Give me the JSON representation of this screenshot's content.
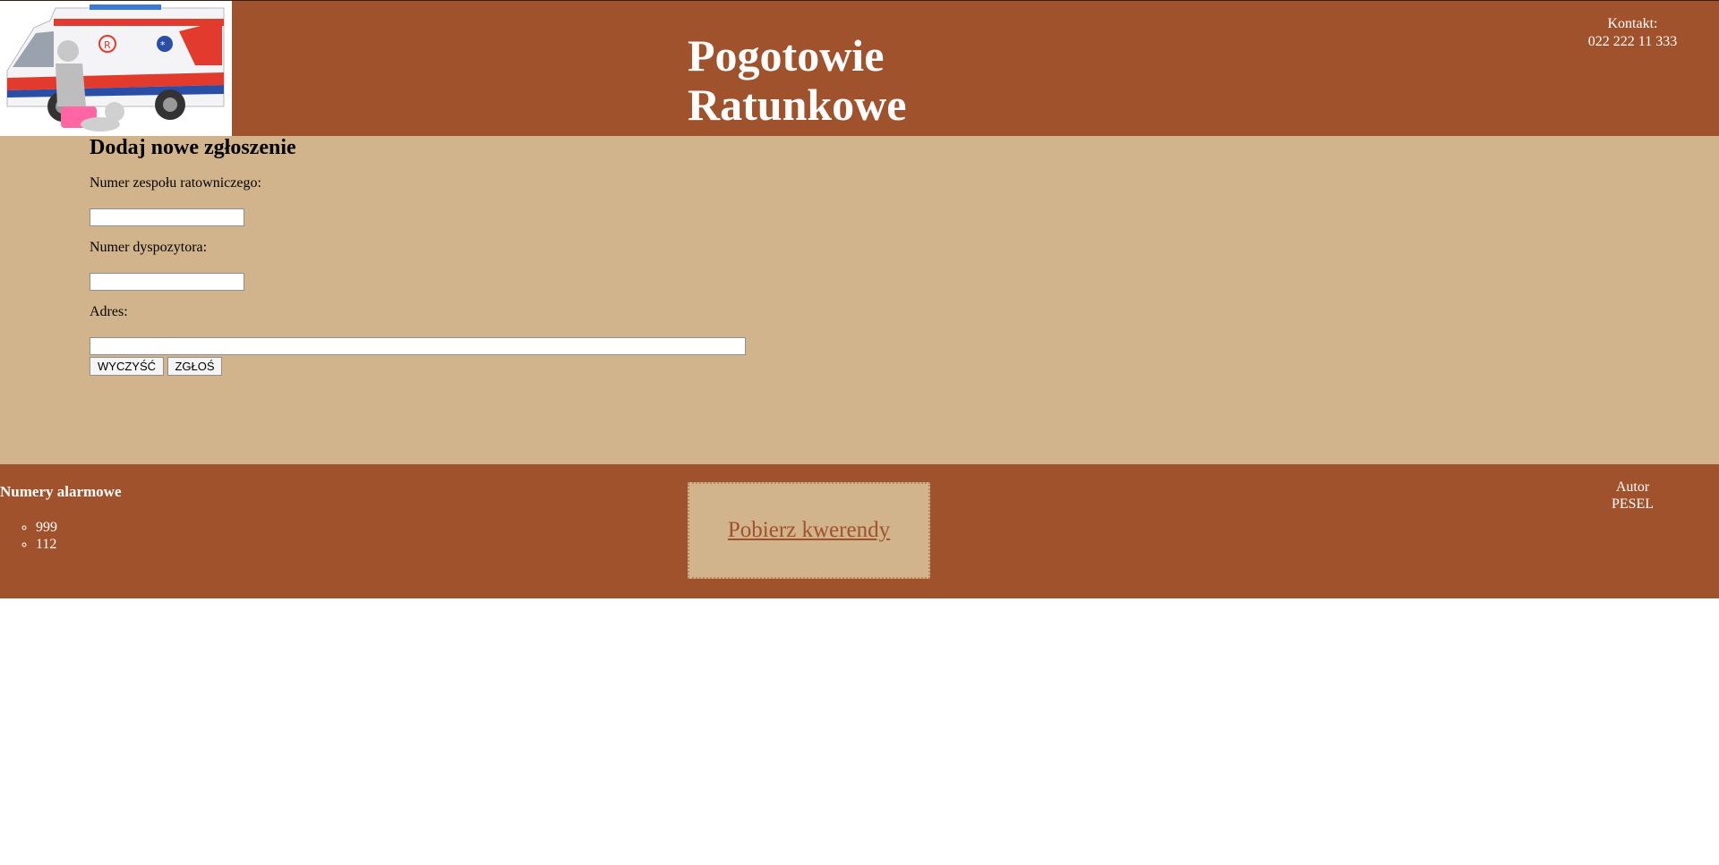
{
  "header": {
    "title_line1": "Pogotowie",
    "title_line2": "Ratunkowe",
    "contact_label": "Kontakt:",
    "contact_phone": "022 222 11 333",
    "logo_icon": "ambulance-illustration-icon"
  },
  "form": {
    "heading": "Dodaj nowe zgłoszenie",
    "team_label": "Numer zespołu ratowniczego:",
    "team_value": "",
    "dispatcher_label": "Numer dyspozytora:",
    "dispatcher_value": "",
    "address_label": "Adres:",
    "address_value": "",
    "clear_button": "WYCZYŚĆ",
    "submit_button": "ZGŁOŚ"
  },
  "footer": {
    "alarm_heading": "Numery alarmowe",
    "alarm_numbers": [
      "999",
      "112"
    ],
    "download_link": "Pobierz kwerendy",
    "author_label": "Autor",
    "author_value": "PESEL"
  },
  "colors": {
    "primary_brown": "#a0522d",
    "tan": "#d2b48c",
    "white": "#ffffff"
  }
}
